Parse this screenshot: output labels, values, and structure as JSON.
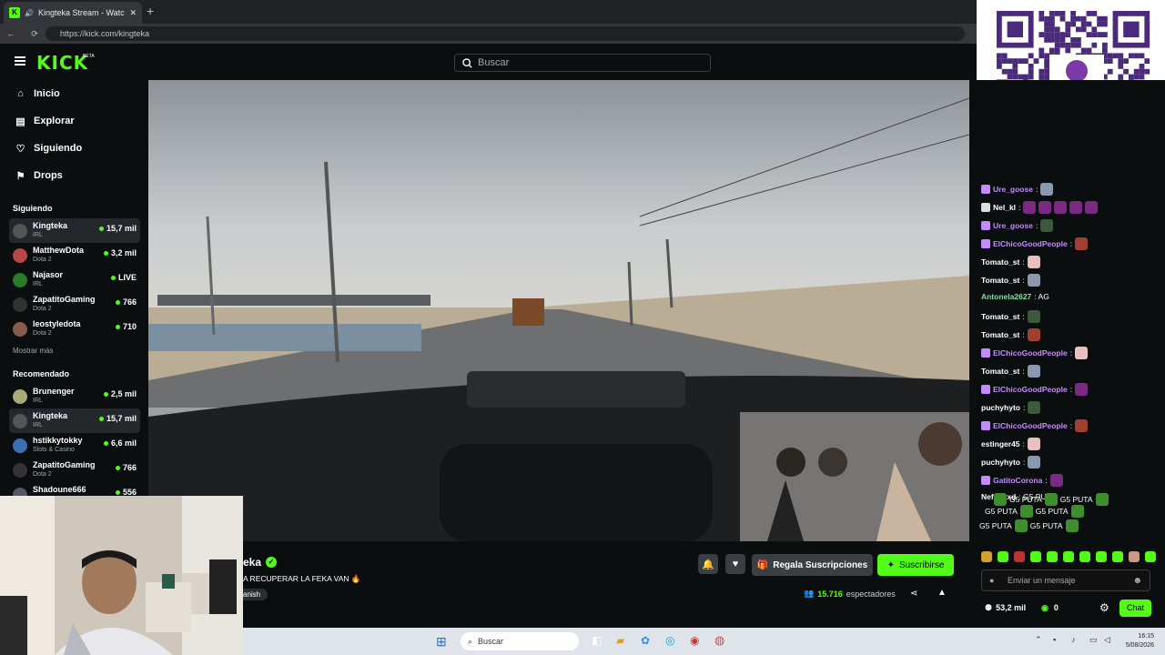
{
  "browser": {
    "tab_title": "Kingteka Stream - Watch Live",
    "url": "https://kick.com/kingteka"
  },
  "header": {
    "logo": "KICK",
    "beta": "BETA",
    "search_placeholder": "Buscar"
  },
  "nav": [
    {
      "label": "Inicio",
      "icon": "home-icon"
    },
    {
      "label": "Explorar",
      "icon": "compass-icon"
    },
    {
      "label": "Siguiendo",
      "icon": "heart-icon"
    },
    {
      "label": "Drops",
      "icon": "drops-icon"
    }
  ],
  "following": {
    "heading": "Siguiendo",
    "channels": [
      {
        "name": "Kingteka",
        "category": "IRL",
        "viewers": "15,7 mil",
        "active": true
      },
      {
        "name": "MatthewDota",
        "category": "Dota 2",
        "viewers": "3,2 mil"
      },
      {
        "name": "Najasor",
        "category": "IRL",
        "viewers": "LIVE"
      },
      {
        "name": "ZapatitoGaming",
        "category": "Dota 2",
        "viewers": "766"
      },
      {
        "name": "leostyledota",
        "category": "Dota 2",
        "viewers": "710"
      }
    ],
    "more": "Mostrar más"
  },
  "recommended": {
    "heading": "Recomendado",
    "channels": [
      {
        "name": "Brunenger",
        "category": "IRL",
        "viewers": "2,5 mil"
      },
      {
        "name": "Kingteka",
        "category": "IRL",
        "viewers": "15,7 mil",
        "active": true
      },
      {
        "name": "hstikkytokky",
        "category": "Slots & Casino",
        "viewers": "6,6 mil"
      },
      {
        "name": "ZapatitoGaming",
        "category": "Dota 2",
        "viewers": "766"
      },
      {
        "name": "Shadoune666",
        "category": "",
        "viewers": "556"
      }
    ]
  },
  "stream": {
    "name_visible": "eka",
    "title_visible": "A RECUPERAR LA FEKA VAN 🔥",
    "tag_visible": "anish",
    "gift_label": "Regala Suscripciones",
    "subscribe_label": "Suscribirse",
    "viewers_count": "15.716",
    "viewers_label": "espectadores"
  },
  "chat": {
    "messages": [
      {
        "user": "Ure_goose",
        "color": "#c48bff",
        "text": ":",
        "emotes": 1
      },
      {
        "user": "Nel_kl",
        "color": "#ffffff",
        "text": ":",
        "emotes": 5
      },
      {
        "user": "Ure_goose",
        "color": "#c48bff",
        "text": ":",
        "emotes": 1
      },
      {
        "user": "ElChicoGoodPeople",
        "color": "#c48bff",
        "text": ":",
        "emotes": 1
      },
      {
        "user": "Tomato_st",
        "color": "#ffffff",
        "text": ":",
        "emotes": 1
      },
      {
        "user": "Tomato_st",
        "color": "#ffffff",
        "text": ":",
        "emotes": 1
      },
      {
        "user": "Antonela2627",
        "color": "#7ee0a0",
        "text": ": AG",
        "emotes": 0
      },
      {
        "user": "Tomato_st",
        "color": "#ffffff",
        "text": ":",
        "emotes": 1
      },
      {
        "user": "Tomato_st",
        "color": "#ffffff",
        "text": ":",
        "emotes": 1
      },
      {
        "user": "ElChicoGoodPeople",
        "color": "#c48bff",
        "text": ":",
        "emotes": 1
      },
      {
        "user": "Tomato_st",
        "color": "#ffffff",
        "text": ":",
        "emotes": 1
      },
      {
        "user": "ElChicoGoodPeople",
        "color": "#c48bff",
        "text": ":",
        "emotes": 1
      },
      {
        "user": "puchyhyto",
        "color": "#ffffff",
        "text": ":",
        "emotes": 1
      },
      {
        "user": "ElChicoGoodPeople",
        "color": "#c48bff",
        "text": ":",
        "emotes": 1
      },
      {
        "user": "estinger45",
        "color": "#ffffff",
        "text": ":",
        "emotes": 1
      },
      {
        "user": "puchyhyto",
        "color": "#ffffff",
        "text": ":",
        "emotes": 1
      },
      {
        "user": "GatitoCorona",
        "color": "#c48bff",
        "text": ":",
        "emotes": 1
      },
      {
        "user": "Neftalyxd",
        "color": "#ffffff",
        "text": ": G5 PUTA",
        "emotes": 0
      }
    ],
    "spam_line": "G5 PUTA",
    "input_placeholder": "Enviar un mensaje",
    "points": "53,2 mil",
    "kicks": "0",
    "chat_button": "Chat"
  },
  "taskbar": {
    "search": "Buscar",
    "time": "16:15",
    "date": "5/08/2026"
  },
  "colors": {
    "accent": "#53fc18",
    "bg": "#0b0e0f"
  }
}
